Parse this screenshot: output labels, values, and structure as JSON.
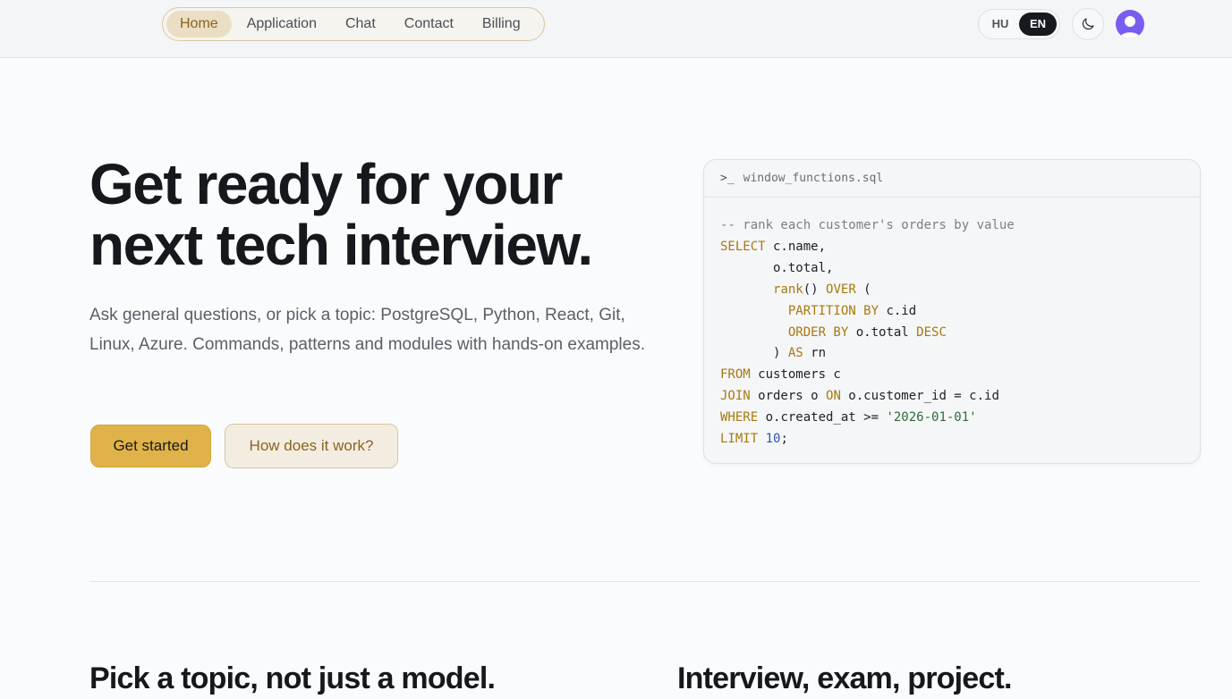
{
  "nav": {
    "items": [
      "Home",
      "Application",
      "Chat",
      "Contact",
      "Billing"
    ],
    "active": "Home"
  },
  "lang": {
    "options": [
      "HU",
      "EN"
    ],
    "selected": "EN"
  },
  "hero": {
    "title_line1": "Get ready for your",
    "title_line2": "next tech interview.",
    "subtitle": "Ask general questions, or pick a topic: PostgreSQL, Python, React, Git, Linux, Azure. Commands, patterns and modules with hands-on examples.",
    "primary_button": "Get started",
    "secondary_button": "How does it work?"
  },
  "code": {
    "filename": "window_functions.sql",
    "prompt_symbol": ">_",
    "lines": [
      [
        [
          "com",
          "-- rank each customer's orders by value"
        ]
      ],
      [
        [
          "kw",
          "SELECT"
        ],
        [
          "txt",
          " c.name,"
        ]
      ],
      [
        [
          "txt",
          "       o.total,"
        ]
      ],
      [
        [
          "txt",
          "       "
        ],
        [
          "fn",
          "rank"
        ],
        [
          "txt",
          "() "
        ],
        [
          "kw",
          "OVER"
        ],
        [
          "txt",
          " ("
        ]
      ],
      [
        [
          "txt",
          "         "
        ],
        [
          "kw",
          "PARTITION BY"
        ],
        [
          "txt",
          " c.id"
        ]
      ],
      [
        [
          "txt",
          "         "
        ],
        [
          "kw",
          "ORDER BY"
        ],
        [
          "txt",
          " o.total "
        ],
        [
          "kw",
          "DESC"
        ]
      ],
      [
        [
          "txt",
          "       ) "
        ],
        [
          "kw",
          "AS"
        ],
        [
          "txt",
          " rn"
        ]
      ],
      [
        [
          "kw",
          "FROM"
        ],
        [
          "txt",
          " customers c"
        ]
      ],
      [
        [
          "kw",
          "JOIN"
        ],
        [
          "txt",
          " orders o "
        ],
        [
          "kw",
          "ON"
        ],
        [
          "txt",
          " o.customer_id = c.id"
        ]
      ],
      [
        [
          "kw",
          "WHERE"
        ],
        [
          "txt",
          " o.created_at >= "
        ],
        [
          "str",
          "'2026-01-01'"
        ]
      ],
      [
        [
          "kw",
          "LIMIT"
        ],
        [
          "txt",
          " "
        ],
        [
          "num",
          "10"
        ],
        [
          "txt",
          ";"
        ]
      ]
    ]
  },
  "sections": {
    "left_title": "Pick a topic, not just a model.",
    "right_title": "Interview, exam, project."
  },
  "colors": {
    "accent": "#e0b24a",
    "accent_text": "#8a6420",
    "avatar": "#7a5cf0"
  }
}
